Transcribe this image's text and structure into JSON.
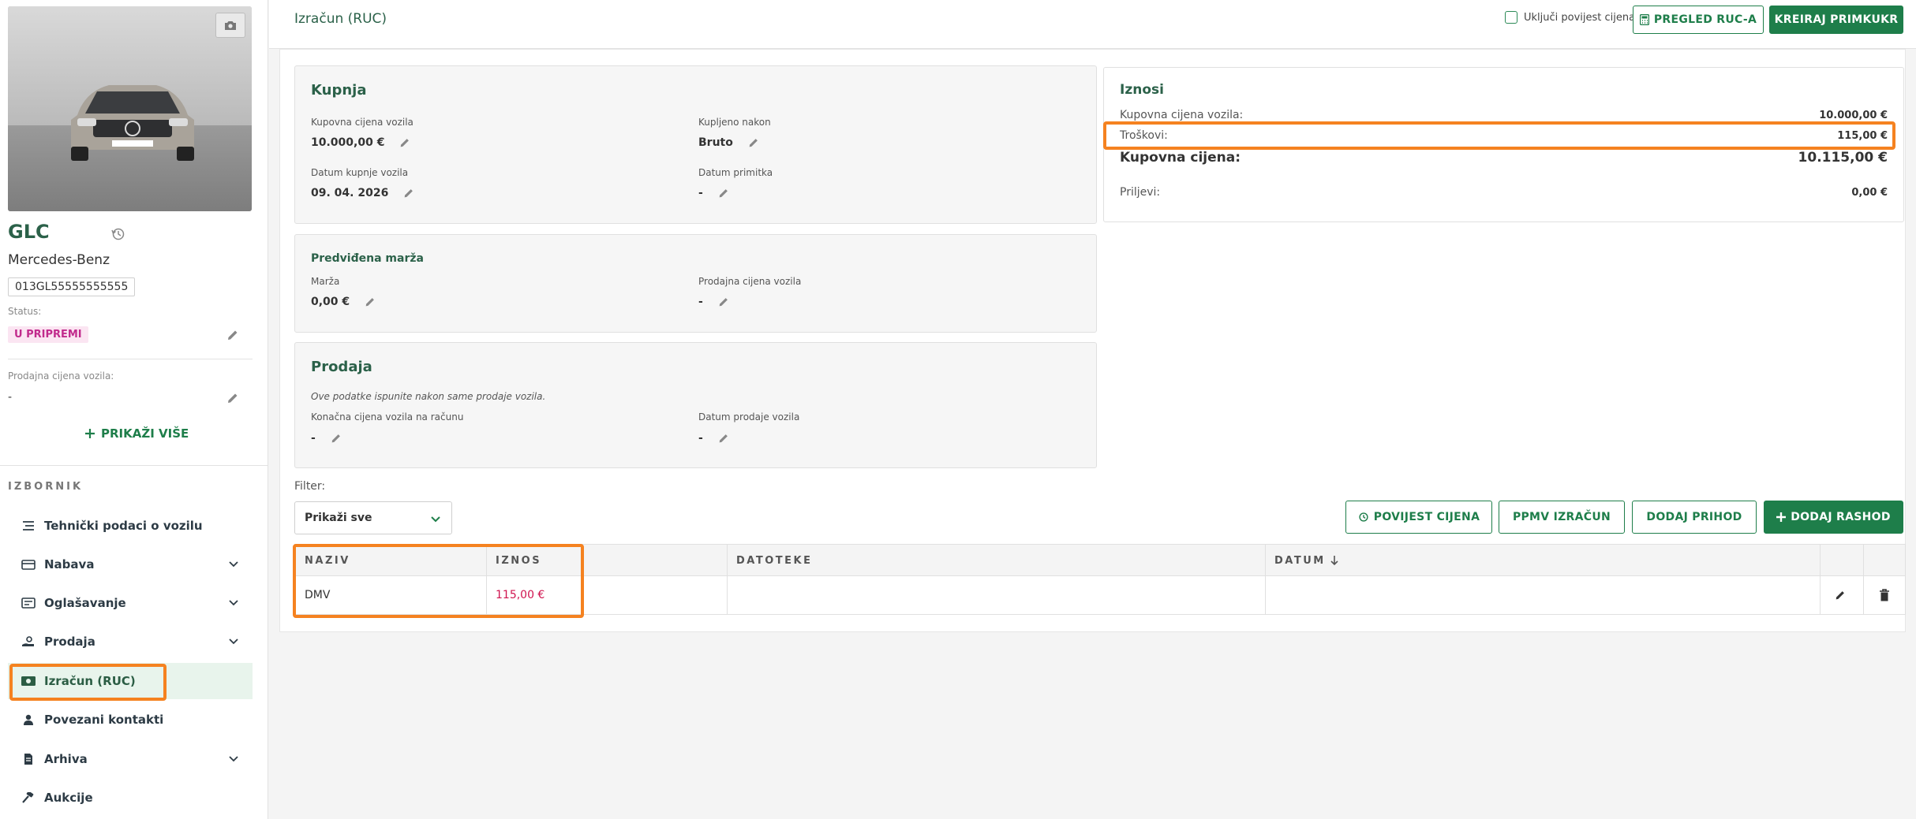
{
  "vehicle": {
    "model": "GLC",
    "make": "Mercedes-Benz",
    "vin": "013GL55555555555",
    "status_label": "Status:",
    "status": "U PRIPREMI",
    "sale_price_label": "Prodajna cijena vozila:",
    "sale_price_value": "-",
    "show_more": "PRIKAŽI VIŠE"
  },
  "menu": {
    "title": "IZBORNIK",
    "items": [
      {
        "label": "Tehnički podaci o vozilu",
        "icon": "list-icon",
        "expandable": false
      },
      {
        "label": "Nabava",
        "icon": "wallet-icon",
        "expandable": true
      },
      {
        "label": "Oglašavanje",
        "icon": "card-icon",
        "expandable": true
      },
      {
        "label": "Prodaja",
        "icon": "hand-icon",
        "expandable": true
      },
      {
        "label": "Izračun (RUC)",
        "icon": "money-icon",
        "expandable": false,
        "active": true
      },
      {
        "label": "Povezani kontakti",
        "icon": "user-icon",
        "expandable": false
      },
      {
        "label": "Arhiva",
        "icon": "file-icon",
        "expandable": true
      },
      {
        "label": "Aukcije",
        "icon": "gavel-icon",
        "expandable": false
      }
    ]
  },
  "header": {
    "title": "Izračun (RUC)",
    "include_history_label": "Uključi povijest cijena",
    "preview_button": "PREGLED RUC-A",
    "create_button": "KREIRAJ PRIMKUKR"
  },
  "kupnja": {
    "title": "Kupnja",
    "purchase_price_label": "Kupovna cijena vozila",
    "purchase_price_value": "10.000,00 €",
    "bought_after_label": "Kupljeno nakon",
    "bought_after_value": "Bruto",
    "purchase_date_label": "Datum kupnje vozila",
    "purchase_date_value": "09. 04. 2026",
    "receipt_date_label": "Datum primitka",
    "receipt_date_value": "-"
  },
  "marza": {
    "title": "Predviđena marža",
    "margin_label": "Marža",
    "margin_value": "0,00 €",
    "sale_price_label": "Prodajna cijena vozila",
    "sale_price_value": "-"
  },
  "prodaja": {
    "title": "Prodaja",
    "note": "Ove podatke ispunite nakon same prodaje vozila.",
    "final_price_label": "Konačna cijena vozila na računu",
    "final_price_value": "-",
    "sale_date_label": "Datum prodaje vozila",
    "sale_date_value": "-"
  },
  "iznosi": {
    "title": "Iznosi",
    "rows": [
      {
        "label": "Kupovna cijena vozila:",
        "value": "10.000,00 €"
      },
      {
        "label": "Troškovi:",
        "value": "115,00 €"
      }
    ],
    "total_label": "Kupovna cijena:",
    "total_value": "10.115,00 €",
    "income_label": "Priljevi:",
    "income_value": "0,00 €"
  },
  "filter": {
    "label": "Filter:",
    "selected": "Prikaži sve"
  },
  "actions": {
    "price_history": "POVIJEST CIJENA",
    "ppmv": "PPMV IZRAČUN",
    "add_income": "DODAJ PRIHOD",
    "add_expense": "DODAJ RASHOD"
  },
  "table": {
    "headers": [
      "NAZIV",
      "IZNOS",
      "DATOTEKE",
      "DATUM"
    ],
    "rows": [
      {
        "naziv": "DMV",
        "iznos": "115,00 €",
        "datoteke": "",
        "datum": ""
      }
    ]
  },
  "colors": {
    "brand_green": "#1e7e4a",
    "title_green": "#2b6149",
    "highlight_orange": "#f58220",
    "expense_red": "#d0144f",
    "status_pink": "#c12a8c"
  }
}
